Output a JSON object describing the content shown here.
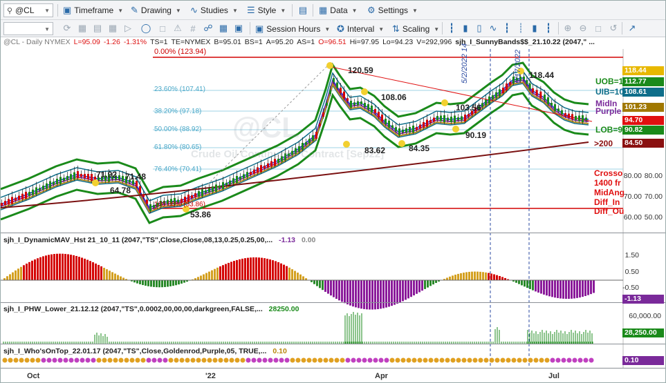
{
  "toolbar": {
    "symbol": "@CL",
    "timeframe": "Timeframe",
    "drawing": "Drawing",
    "studies": "Studies",
    "style": "Style",
    "data": "Data",
    "settings": "Settings",
    "session_hours": "Session Hours",
    "interval": "Interval",
    "scaling": "Scaling"
  },
  "header": {
    "symbol": "@CL - Daily  NYMEX",
    "last": "L=95.09",
    "change": "-1.26",
    "pct": "-1.31%",
    "ts": "TS=1",
    "te": "TE=NYMEX",
    "bid": "B=95.01",
    "bs": "BS=1",
    "ask": "A=95.20",
    "as": "AS=1",
    "open": "O=96.51",
    "hi": "Hi=97.95",
    "lo": "Lo=94.23",
    "vol": "V=292,996",
    "study": "sjh_I_SunnyBands$$_21.10.22 (2047,\" ..."
  },
  "fib_levels": [
    "0.00% (123.94)",
    "23.60% (107.41)",
    "38.20% (97.18)",
    "50.00% (88.92)",
    "61.80% (80.65)",
    "76.40% (70.41)",
    "100.00% (53.86)"
  ],
  "price_labels": [
    "71.92",
    "71.48",
    "64.78",
    "53.86",
    "120.59",
    "108.06",
    "83.62",
    "84.35",
    "103.56",
    "90.19",
    "118.44"
  ],
  "watermark": "@CL",
  "watermark_sub": "Crude Oil Continuous Contract [Sep22]",
  "band_labels": [
    "UOB=1",
    "UIB=10",
    "MidIn",
    "Purple",
    "LOB=9",
    ">200"
  ],
  "cross_labels": [
    "Crosso",
    "1400 fr",
    "MidAng",
    "Diff_In",
    "Diff_Ou"
  ],
  "vert_labels": [
    "5/2/2022 14",
    "6/17/2022"
  ],
  "price_tags": [
    {
      "value": "118.44",
      "color": "#e8b800"
    },
    {
      "value": "112.77",
      "color": "#1a8a1a"
    },
    {
      "value": "108.61",
      "color": "#0e6e8a"
    },
    {
      "value": "101.23",
      "color": "#a07800"
    },
    {
      "value": "94.70",
      "color": "#e01010"
    },
    {
      "value": "90.82",
      "color": "#1a8a1a"
    },
    {
      "value": "84.50",
      "color": "#8a1010"
    }
  ],
  "price_axis": [
    "80.00",
    "70.00",
    "60.00",
    "50.00"
  ],
  "ind1": {
    "label": "sjh_I_DynamicMAV_Hst 21_10_11 (2047,\"TS\",Close,Close,08,13,0.25,0.25,00,...",
    "v1": "-1.13",
    "v2": "0.00",
    "axis": [
      "1.50",
      "0.50",
      "-0.50"
    ],
    "tag": "-1.13"
  },
  "ind2": {
    "label": "sjh_I_PHW_Lower_21.12.12 (2047,\"TS\",0.0002,00,00,00,darkgreen,FALSE,...",
    "v1": "28250.00",
    "axis": [
      "60,000.00"
    ],
    "tag": "28,250.00"
  },
  "ind3": {
    "label": "sjh_I_Who'sOnTop_22.01.17 (2047,\"TS\",Close,Goldenrod,Purple,05, TRUE,...",
    "v1": "0.10",
    "tag": "0.10"
  },
  "x_axis": [
    "Oct",
    "'22",
    "Apr",
    "Jul"
  ]
}
